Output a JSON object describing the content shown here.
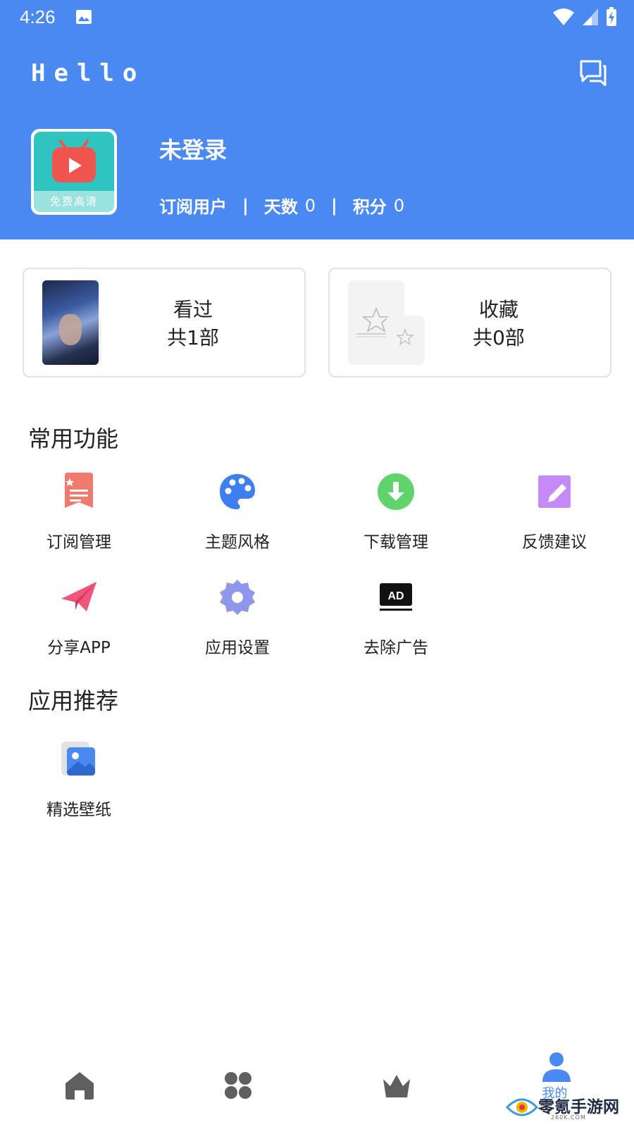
{
  "status_bar": {
    "time": "4:26",
    "icons": [
      "image-icon",
      "wifi-icon",
      "signal-icon",
      "battery-charging-icon"
    ]
  },
  "header": {
    "greeting": "Hello",
    "message_icon": "chat-icon",
    "app_icon_badge": "免费高清",
    "user_name": "未登录",
    "stats": {
      "subscription_label": "订阅用户",
      "days_label": "天数",
      "days_value": "0",
      "points_label": "积分",
      "points_value": "0"
    }
  },
  "cards": {
    "history": {
      "title": "看过",
      "count": "共1部"
    },
    "favorites": {
      "title": "收藏",
      "count": "共0部"
    }
  },
  "common_functions": {
    "title": "常用功能",
    "items": [
      {
        "label": "订阅管理",
        "icon": "subscription-icon"
      },
      {
        "label": "主题风格",
        "icon": "palette-icon"
      },
      {
        "label": "下载管理",
        "icon": "download-icon"
      },
      {
        "label": "反馈建议",
        "icon": "feedback-edit-icon"
      },
      {
        "label": "分享APP",
        "icon": "paper-plane-icon"
      },
      {
        "label": "应用设置",
        "icon": "settings-gear-icon"
      },
      {
        "label": "去除广告",
        "icon": "ad-icon",
        "icon_text": "AD"
      }
    ]
  },
  "recommendations": {
    "title": "应用推荐",
    "items": [
      {
        "label": "精选壁纸",
        "icon": "wallpaper-icon"
      }
    ]
  },
  "bottom_nav": {
    "items": [
      {
        "icon": "home-icon"
      },
      {
        "icon": "apps-grid-icon"
      },
      {
        "icon": "crown-icon"
      },
      {
        "icon": "user-icon",
        "label": "我的",
        "active": true
      }
    ]
  },
  "watermark": {
    "text": "零氪手游网",
    "sub": "260K.COM"
  },
  "colors": {
    "header_blue": "#4a88f2",
    "subscription_red": "#f07a6e",
    "palette_blue": "#3d7ef0",
    "download_green": "#5fd46a",
    "feedback_purple": "#c58af5",
    "share_pink": "#f2557c",
    "settings_lavender": "#8f97ea",
    "nav_gray": "#5f5f5f"
  }
}
